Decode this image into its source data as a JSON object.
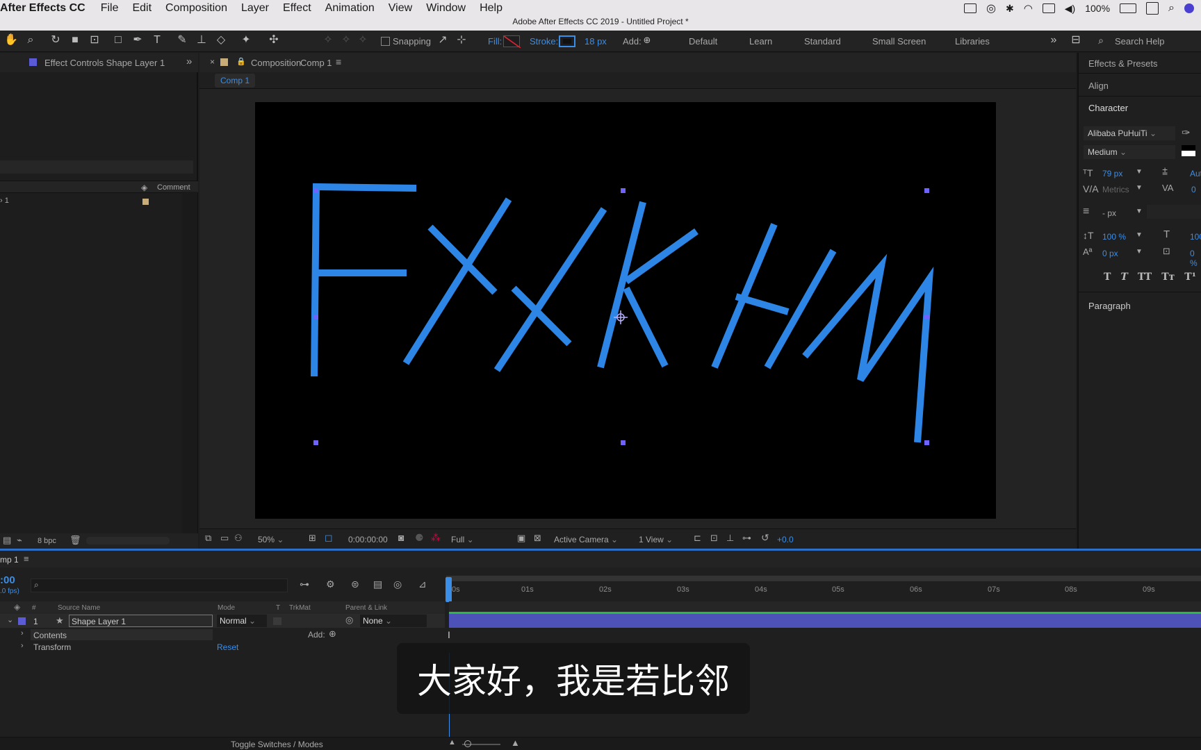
{
  "menubar": {
    "app_name": "After Effects CC",
    "items": [
      "File",
      "Edit",
      "Composition",
      "Layer",
      "Effect",
      "Animation",
      "View",
      "Window",
      "Help"
    ],
    "battery": "100%"
  },
  "window_title": "Adobe After Effects CC 2019 - Untitled Project *",
  "toolbar": {
    "snapping_label": "Snapping",
    "fill_label": "Fill:",
    "stroke_label": "Stroke:",
    "stroke_width": "18 px",
    "add_label": "Add:",
    "workspaces": [
      "Default",
      "Learn",
      "Standard",
      "Small Screen",
      "Libraries"
    ],
    "search_placeholder": "Search Help"
  },
  "left_panel": {
    "tab_label": "Effect Controls Shape Layer 1",
    "comment_header": "Comment",
    "row_label": "› 1",
    "bpc": "8 bpc"
  },
  "composition_panel": {
    "tab_prefix": "Composition",
    "tab_name": "Comp 1",
    "subtab": "Comp 1",
    "zoom": "50%",
    "timecode": "0:00:00:00",
    "resolution": "Full",
    "camera": "Active Camera",
    "views": "1 View",
    "exposure": "+0.0"
  },
  "right_panel": {
    "effects_presets": "Effects & Presets",
    "align": "Align",
    "character": "Character",
    "font_family": "Alibaba PuHuiTi",
    "font_style": "Medium",
    "font_size": "79 px",
    "leading": "Aut",
    "kerning": "Metrics",
    "tracking": "0",
    "stroke_width": "- px",
    "vert_scale": "100 %",
    "horiz_scale": "100",
    "baseline": "0 px",
    "tsume": "0 %",
    "style_buttons": [
      "T",
      "T",
      "TT",
      "Tт",
      "T¹"
    ],
    "paragraph": "Paragraph"
  },
  "timeline": {
    "tab_label": "mp 1",
    "timecode": ":00",
    "fps": ".0 fps)",
    "headers": {
      "num": "#",
      "source": "Source Name",
      "mode": "Mode",
      "t": "T",
      "trkmat": "TrkMat",
      "parent": "Parent & Link"
    },
    "layer": {
      "index": "1",
      "name": "Shape Layer 1",
      "mode": "Normal",
      "parent": "None"
    },
    "contents_label": "Contents",
    "add_label": "Add:",
    "transform_label": "Transform",
    "reset_label": "Reset",
    "ruler": [
      "0s",
      "01s",
      "02s",
      "03s",
      "04s",
      "05s",
      "06s",
      "07s",
      "08s",
      "09s"
    ],
    "toggle_label": "Toggle Switches / Modes"
  },
  "subtitle_text": "大家好，我是若比邻",
  "colors": {
    "stroke_blue": "#2d86e6",
    "accent_blue": "#3a8ee8",
    "layer_bar": "#4d52b8",
    "selection_handle": "#6f63ff"
  }
}
